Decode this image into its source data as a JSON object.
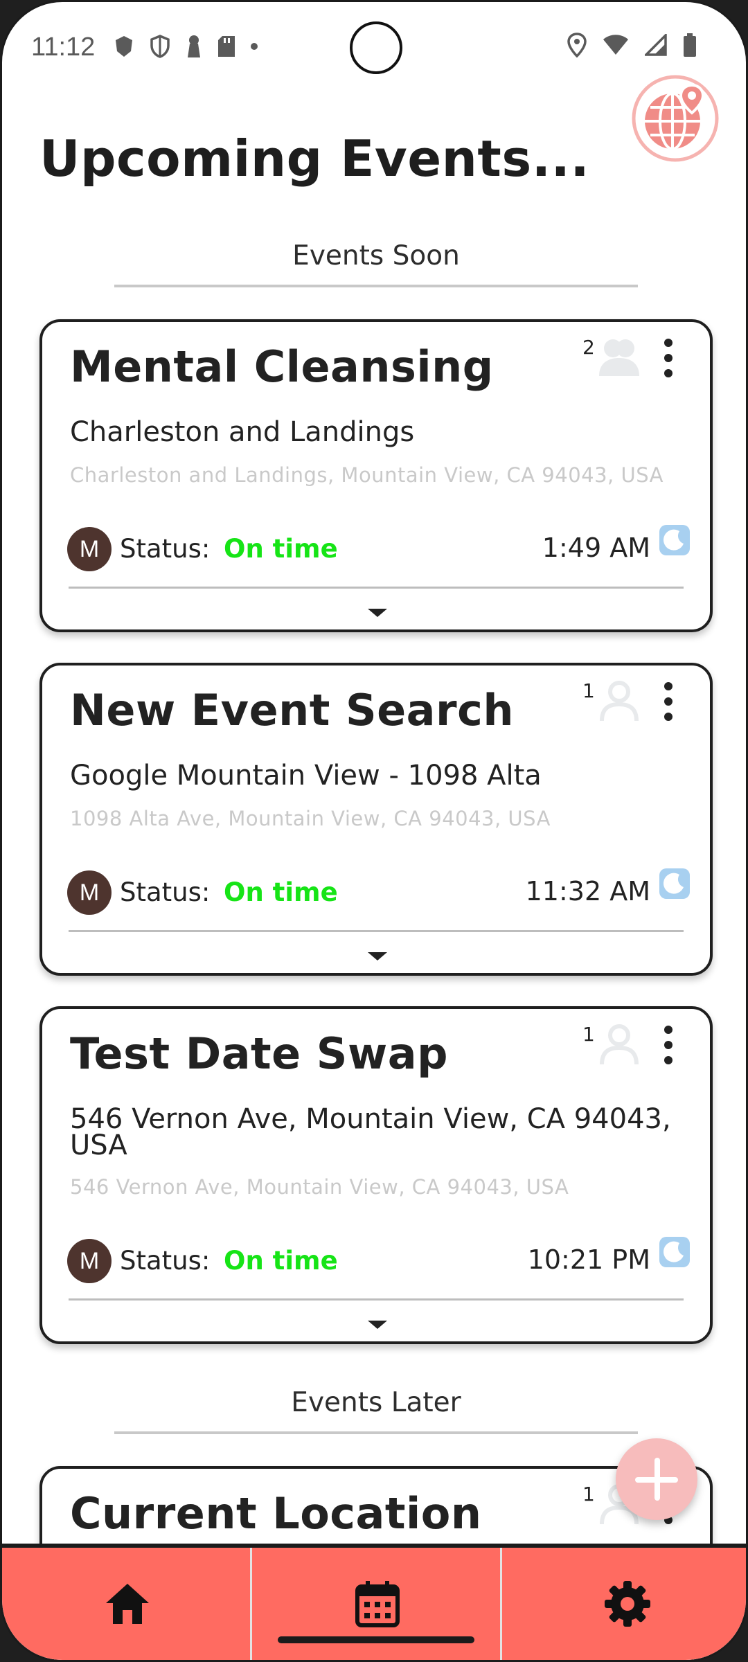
{
  "status_bar": {
    "time": "11:12",
    "left_icons": [
      "shield-blocker-icon",
      "shield-outline-icon",
      "keyhole-icon",
      "sd-card-icon",
      "dot-icon"
    ],
    "right_icons": [
      "location-pin-icon",
      "wifi-icon",
      "signal-icon",
      "battery-icon"
    ]
  },
  "header": {
    "title": "Upcoming Events...",
    "logo_icon": "globe-location-icon"
  },
  "sections": {
    "soon": "Events Soon",
    "later": "Events Later"
  },
  "events_soon": [
    {
      "title": "Mental Cleansing",
      "place": "Charleston and Landings",
      "address": "Charleston and Landings, Mountain View, CA 94043, USA",
      "attendees": "2",
      "avatar_initial": "M",
      "status_label": "Status:",
      "status_value": "On time",
      "time": "1:49 AM"
    },
    {
      "title": "New Event Search",
      "place": "Google Mountain View - 1098 Alta",
      "address": "1098 Alta Ave, Mountain View, CA 94043, USA",
      "attendees": "1",
      "avatar_initial": "M",
      "status_label": "Status:",
      "status_value": "On time",
      "time": "11:32 AM"
    },
    {
      "title": "Test Date Swap",
      "place": "546 Vernon Ave, Mountain View, CA 94043, USA",
      "address": "546 Vernon Ave, Mountain View, CA 94043, USA",
      "attendees": "1",
      "avatar_initial": "M",
      "status_label": "Status:",
      "status_value": "On time",
      "time": "10:21 PM"
    }
  ],
  "events_later": [
    {
      "title": "Current Location",
      "attendees": "1"
    }
  ],
  "colors": {
    "accent": "#ff6b61",
    "status_ok": "#16e416",
    "avatar_bg": "#4e342e",
    "fab": "#f7bcbc",
    "clock": "#9ec9ee"
  },
  "bottom_nav": {
    "items": [
      "home-icon",
      "calendar-icon",
      "settings-gear-icon"
    ]
  }
}
